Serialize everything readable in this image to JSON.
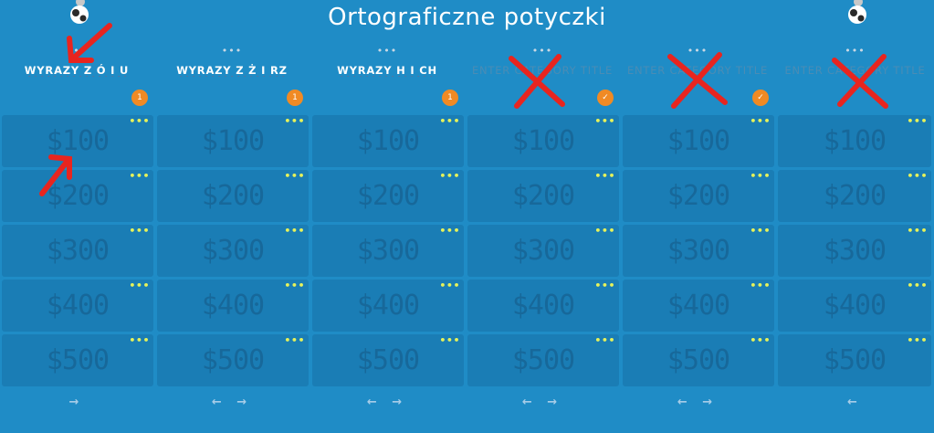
{
  "header": {
    "title": "Ortograficzne potyczki"
  },
  "columns": [
    {
      "menu": "•••",
      "title": "WYRAZY Z Ó I U",
      "badge": "1",
      "arrows": "→",
      "tiles": [
        {
          "amount": "$100",
          "dots": "•••"
        },
        {
          "amount": "$200",
          "dots": "•••"
        },
        {
          "amount": "$300",
          "dots": "•••"
        },
        {
          "amount": "$400",
          "dots": "•••"
        },
        {
          "amount": "$500",
          "dots": "•••"
        }
      ]
    },
    {
      "menu": "•••",
      "title": "WYRAZY Z Ż I RZ",
      "badge": "1",
      "arrows": "← →",
      "tiles": [
        {
          "amount": "$100",
          "dots": "•••"
        },
        {
          "amount": "$200",
          "dots": "•••"
        },
        {
          "amount": "$300",
          "dots": "•••"
        },
        {
          "amount": "$400",
          "dots": "•••"
        },
        {
          "amount": "$500",
          "dots": "•••"
        }
      ]
    },
    {
      "menu": "•••",
      "title": "WYRAZY H I CH",
      "badge": "1",
      "arrows": "← →",
      "tiles": [
        {
          "amount": "$100",
          "dots": "•••"
        },
        {
          "amount": "$200",
          "dots": "•••"
        },
        {
          "amount": "$300",
          "dots": "•••"
        },
        {
          "amount": "$400",
          "dots": "•••"
        },
        {
          "amount": "$500",
          "dots": "•••"
        }
      ]
    },
    {
      "menu": "•••",
      "title": "ENTER CATEGORY TITLE",
      "badge": "✓",
      "arrows": "← →",
      "tiles": [
        {
          "amount": "$100",
          "dots": "•••"
        },
        {
          "amount": "$200",
          "dots": "•••"
        },
        {
          "amount": "$300",
          "dots": "•••"
        },
        {
          "amount": "$400",
          "dots": "•••"
        },
        {
          "amount": "$500",
          "dots": "•••"
        }
      ]
    },
    {
      "menu": "•••",
      "title": "ENTER CATEGORY TITLE",
      "badge": "✓",
      "arrows": "← →",
      "tiles": [
        {
          "amount": "$100",
          "dots": "•••"
        },
        {
          "amount": "$200",
          "dots": "•••"
        },
        {
          "amount": "$300",
          "dots": "•••"
        },
        {
          "amount": "$400",
          "dots": "•••"
        },
        {
          "amount": "$500",
          "dots": "•••"
        }
      ]
    },
    {
      "menu": "•••",
      "title": "ENTER CATEGORY TITLE",
      "badge": "",
      "arrows": "←",
      "tiles": [
        {
          "amount": "$100",
          "dots": "•••"
        },
        {
          "amount": "$200",
          "dots": "•••"
        },
        {
          "amount": "$300",
          "dots": "•••"
        },
        {
          "amount": "$400",
          "dots": "•••"
        },
        {
          "amount": "$500",
          "dots": "•••"
        }
      ]
    }
  ]
}
